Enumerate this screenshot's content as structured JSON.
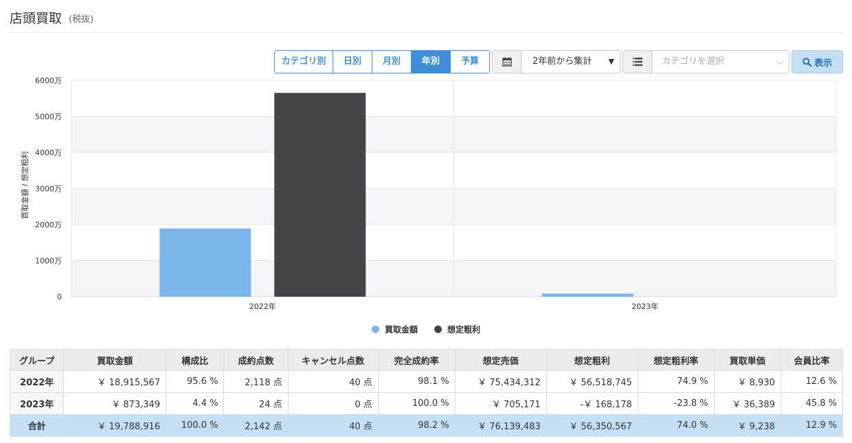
{
  "header": {
    "title": "店頭買取",
    "subtitle": "(税抜)"
  },
  "toolbar": {
    "tabs": [
      {
        "label": "カテゴリ別",
        "active": false
      },
      {
        "label": "日別",
        "active": false
      },
      {
        "label": "月別",
        "active": false
      },
      {
        "label": "年別",
        "active": true
      },
      {
        "label": "予算",
        "active": false
      }
    ],
    "period_select": {
      "icon": "calendar-icon",
      "value": "2年前から集計"
    },
    "category_select": {
      "icon": "list-icon",
      "placeholder": "カテゴリを選択"
    },
    "show_button": {
      "icon": "search-icon",
      "label": "表示"
    }
  },
  "colors": {
    "accent": "#3d8fd8",
    "series1": "#7cb5ec",
    "series2": "#434348",
    "total_row": "#c5dff5"
  },
  "chart_data": {
    "type": "bar",
    "categories": [
      "2022年",
      "2023年"
    ],
    "series": [
      {
        "name": "買取金額",
        "color": "#7cb5ec",
        "values": [
          18915567,
          873349
        ]
      },
      {
        "name": "想定粗利",
        "color": "#434348",
        "values": [
          56518745,
          -168178
        ]
      }
    ],
    "ylabel": "買取金額 / 想定粗利",
    "ylim": [
      0,
      60000000
    ],
    "yticks": [
      "0",
      "1000万",
      "2000万",
      "3000万",
      "4000万",
      "5000万",
      "6000万"
    ],
    "grid": true,
    "legend_position": "bottom-center"
  },
  "table": {
    "headers": [
      "グループ",
      "買取金額",
      "構成比",
      "成約点数",
      "キャンセル点数",
      "完全成約率",
      "想定売価",
      "想定粗利",
      "想定粗利率",
      "買取単価",
      "会員比率"
    ],
    "rows": [
      [
        "2022年",
        "￥ 18,915,567",
        "95.6 %",
        "2,118 点",
        "40 点",
        "98.1 %",
        "￥ 75,434,312",
        "￥ 56,518,745",
        "74.9 %",
        "￥ 8,930",
        "12.6 %"
      ],
      [
        "2023年",
        "￥ 873,349",
        "4.4 %",
        "24 点",
        "0 点",
        "100.0 %",
        "￥ 705,171",
        "-￥ 168,178",
        "-23.8 %",
        "￥ 36,389",
        "45.8 %"
      ]
    ],
    "total": [
      "合計",
      "￥ 19,788,916",
      "100.0 %",
      "2,142 点",
      "40 点",
      "98.2 %",
      "￥ 76,139,483",
      "￥ 56,350,567",
      "74.0 %",
      "￥ 9,238",
      "12.9 %"
    ]
  }
}
